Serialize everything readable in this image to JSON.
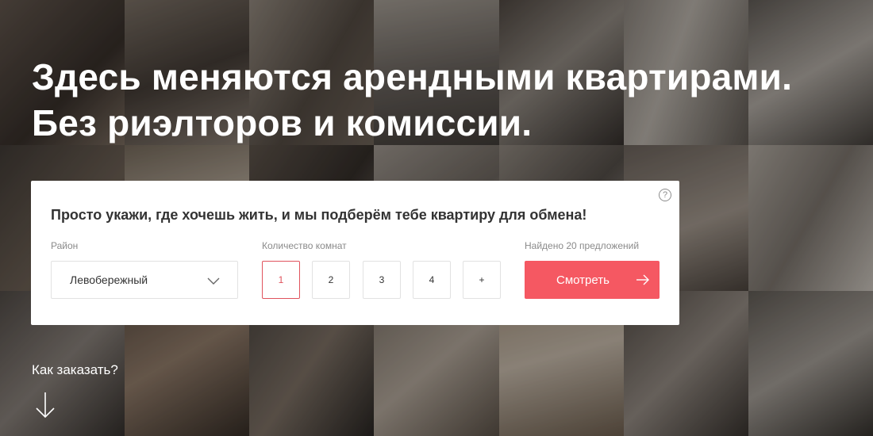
{
  "hero": {
    "line1": "Здесь меняются арендными квартирами.",
    "line2": "Без риэлторов и комиссии."
  },
  "form": {
    "help": "?",
    "title": "Просто укажи, где хочешь жить, и мы подберём тебе квартиру для обмена!",
    "district_label": "Район",
    "district_value": "Левобережный",
    "rooms_label": "Количество комнат",
    "rooms": [
      "1",
      "2",
      "3",
      "4",
      "+"
    ],
    "rooms_selected": "1",
    "found_label": "Найдено 20 предложений",
    "submit_label": "Смотреть"
  },
  "how_to_order": "Как заказать?",
  "colors": {
    "accent": "#f55862",
    "selected_border": "#e0535d"
  },
  "icons": [
    "help-icon",
    "chevron-down-icon",
    "arrow-right-icon",
    "arrow-down-icon"
  ]
}
